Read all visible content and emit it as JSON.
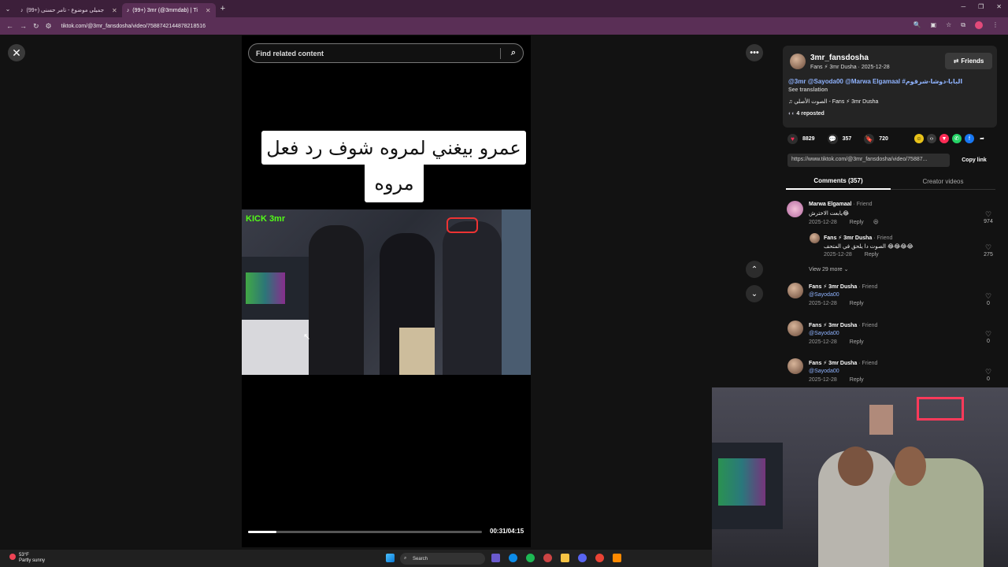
{
  "browser": {
    "tabs": [
      {
        "label": "(99+) جمیلی موضوع - تامر حسنی"
      },
      {
        "label": "(99+) 3mr (@3mmdab) | Ti"
      }
    ],
    "url": "tiktok.com/@3mr_fansdosha/video/7588742144878218516"
  },
  "search": {
    "placeholder": "Find related content"
  },
  "video": {
    "caption_line1": "عمرو بيغني لمروه شوف رد فعل",
    "caption_line2": "مروه",
    "watermark": "KICK 3mr",
    "time": "00:31/04:15",
    "progress": 0.12
  },
  "author": {
    "username": "3mr_fansdosha",
    "meta": "Fans ⚡ 3mr Dusha · 2025-12-28",
    "friends_label": "Friends",
    "description": "@3mr @Sayoda00 @Marwa Elgamaal #البابا-دوشا-شرقوم",
    "see_translation": "See translation",
    "music": "♫ الصوت الأصلي - Fans ⚡ 3mr Dusha",
    "reposted": "4 reposted"
  },
  "stats": {
    "likes": "8829",
    "comments": "357",
    "saves": "720"
  },
  "share": {
    "link": "https://www.tiktok.com/@3mr_fansdosha/video/75887...",
    "copy_label": "Copy link"
  },
  "tabs": {
    "comments": "Comments (357)",
    "creator": "Creator videos"
  },
  "comments": [
    {
      "name": "Marwa Elgamaal",
      "tag": "· Friend",
      "text": "يابعت الاخترش😂",
      "date": "2025-12-28",
      "reply": "Reply",
      "likes": "974"
    },
    {
      "name": "Fans ⚡ 3mr Dusha",
      "tag": "· Friend",
      "text": "الصوت دا يلحق في المتحف 😂😂😂😂",
      "date": "2025-12-28",
      "reply": "Reply",
      "likes": "275"
    },
    {
      "name": "Fans ⚡ 3mr Dusha",
      "tag": "· Friend",
      "text": "@Sayoda00",
      "date": "2025-12-28",
      "reply": "Reply",
      "likes": "0"
    },
    {
      "name": "Fans ⚡ 3mr Dusha",
      "tag": "· Friend",
      "text": "@Sayoda00",
      "date": "2025-12-28",
      "reply": "Reply",
      "likes": "0"
    },
    {
      "name": "Fans ⚡ 3mr Dusha",
      "tag": "· Friend",
      "text": "@Sayoda00",
      "date": "2025-12-28",
      "reply": "Reply",
      "likes": "0"
    }
  ],
  "view_more": "View 29 more ⌄",
  "taskbar": {
    "weather_temp": "53°F",
    "weather_desc": "Partly sunny",
    "search": "Search"
  },
  "colors": {
    "accent": "#fe2c55",
    "link": "#8fb3ff",
    "chrome": "#5a2f56"
  }
}
